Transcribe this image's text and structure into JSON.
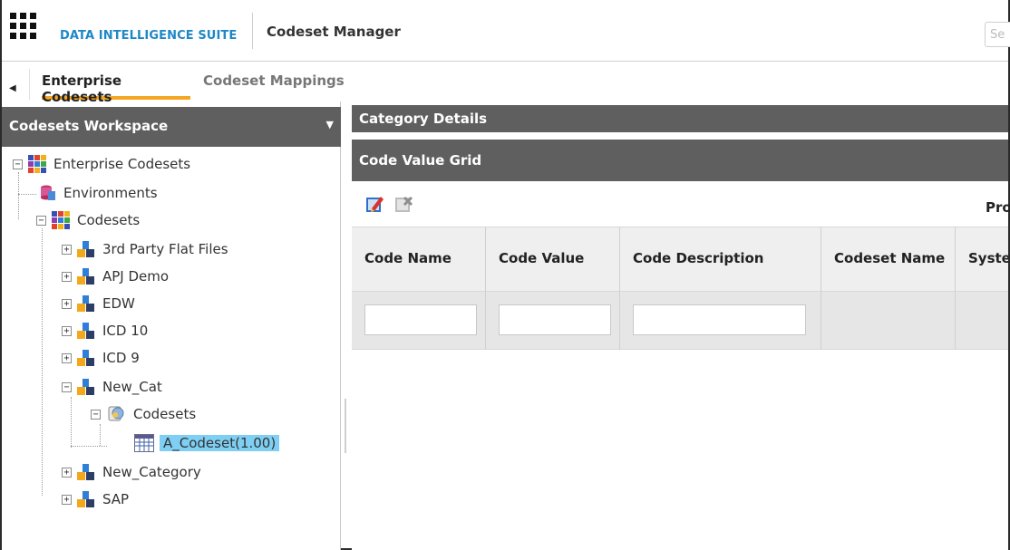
{
  "header": {
    "suite_name": "DATA INTELLIGENCE SUITE",
    "module_name": "Codeset Manager",
    "search_placeholder": "Se"
  },
  "tabs": [
    {
      "label": "Enterprise Codesets",
      "active": true
    },
    {
      "label": "Codeset Mappings",
      "active": false
    }
  ],
  "workspace": {
    "title": "Codesets Workspace",
    "tree": {
      "root": "Enterprise Codesets",
      "environments": "Environments",
      "codesets": "Codesets",
      "categories": [
        "3rd Party Flat Files",
        "APJ Demo",
        "EDW",
        "ICD 10",
        "ICD 9",
        "New_Cat"
      ],
      "new_cat_child": "Codesets",
      "selected_item": "A_Codeset(1.00)",
      "categories_after": [
        "New_Category",
        "SAP"
      ]
    }
  },
  "details": {
    "category_details": "Category Details",
    "code_value_grid": "Code Value Grid",
    "toolbar_right_text": "Pro"
  },
  "grid": {
    "columns": [
      "Code Name",
      "Code Value",
      "Code Description",
      "Codeset Name",
      "Syste"
    ]
  },
  "colors": {
    "accent_blue": "#1e88c7",
    "tab_underline": "#f5a623",
    "panel_header": "#5f5f5f",
    "selection": "#7ecff3"
  }
}
